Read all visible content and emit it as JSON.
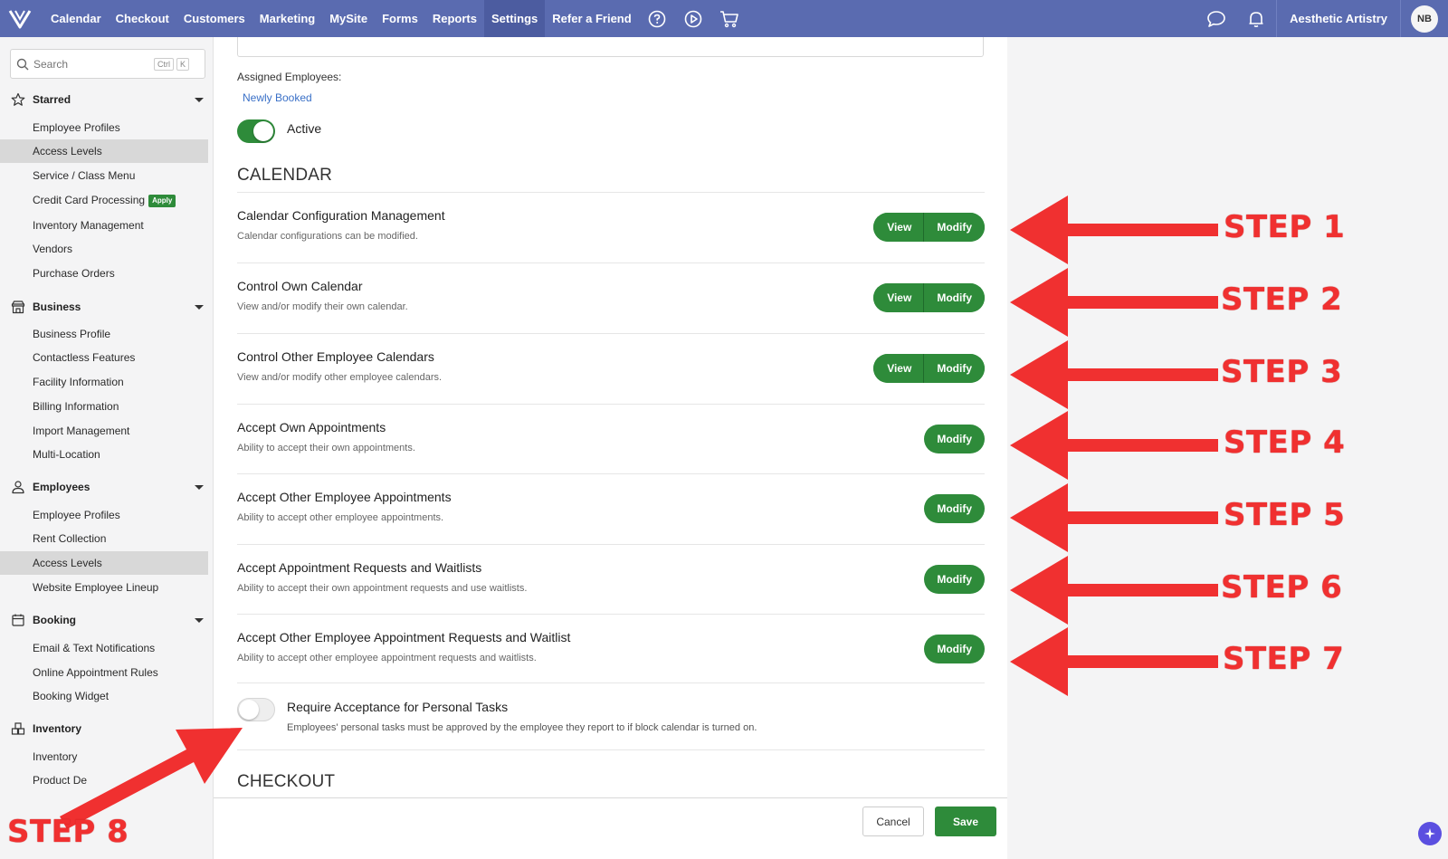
{
  "topbar": {
    "nav": [
      "Calendar",
      "Checkout",
      "Customers",
      "Marketing",
      "MySite",
      "Forms",
      "Reports",
      "Settings",
      "Refer a Friend"
    ],
    "active_nav": "Settings",
    "business_name": "Aesthetic Artistry",
    "avatar_initials": "NB"
  },
  "sidebar": {
    "search": {
      "placeholder": "Search",
      "shortcut_key1": "Ctrl",
      "shortcut_key2": "K"
    },
    "sections": {
      "starred": {
        "title": "Starred",
        "items": [
          "Employee Profiles",
          "Access Levels",
          "Service / Class Menu",
          "Credit Card Processing",
          "Inventory Management",
          "Vendors",
          "Purchase Orders"
        ],
        "badge": "Apply"
      },
      "business": {
        "title": "Business",
        "items": [
          "Business Profile",
          "Contactless Features",
          "Facility Information",
          "Billing Information",
          "Import Management",
          "Multi-Location"
        ]
      },
      "employees": {
        "title": "Employees",
        "items": [
          "Employee Profiles",
          "Rent Collection",
          "Access Levels",
          "Website Employee Lineup"
        ]
      },
      "booking": {
        "title": "Booking",
        "items": [
          "Email & Text Notifications",
          "Online Appointment Rules",
          "Booking Widget"
        ]
      },
      "inventory": {
        "title": "Inventory",
        "items": [
          "Inventory",
          "Product De"
        ]
      }
    }
  },
  "main": {
    "assigned_label": "Assigned Employees:",
    "assigned_value": "Newly Booked",
    "active_label": "Active",
    "calendar_heading": "CALENDAR",
    "checkout_heading": "CHECKOUT",
    "view_label": "View",
    "modify_label": "Modify",
    "permissions": [
      {
        "title": "Calendar Configuration Management",
        "desc": "Calendar configurations can be modified."
      },
      {
        "title": "Control Own Calendar",
        "desc": "View and/or modify their own calendar."
      },
      {
        "title": "Control Other Employee Calendars",
        "desc": "View and/or modify other employee calendars."
      },
      {
        "title": "Accept Own Appointments",
        "desc": "Ability to accept their own appointments."
      },
      {
        "title": "Accept Other Employee Appointments",
        "desc": "Ability to accept other employee appointments."
      },
      {
        "title": "Accept Appointment Requests and Waitlists",
        "desc": "Ability to accept their own appointment requests and use waitlists."
      },
      {
        "title": "Accept Other Employee Appointment Requests and Waitlist",
        "desc": "Ability to accept other employee appointment requests and waitlists."
      }
    ],
    "personal_tasks": {
      "title": "Require Acceptance for Personal Tasks",
      "desc": "Employees' personal tasks must be approved by the employee they report to if block calendar is turned on.",
      "enabled": false
    },
    "active_enabled": true
  },
  "footer": {
    "cancel_label": "Cancel",
    "save_label": "Save"
  },
  "annotations": {
    "steps": [
      "STEP 1",
      "STEP 2",
      "STEP 3",
      "STEP 4",
      "STEP 5",
      "STEP 6",
      "STEP 7",
      "STEP 8"
    ],
    "arrow_color": "#f03030"
  },
  "colors": {
    "topbar": "#5a6bb0",
    "primary_green": "#2e8b3a",
    "link_blue": "#3a70c7"
  }
}
